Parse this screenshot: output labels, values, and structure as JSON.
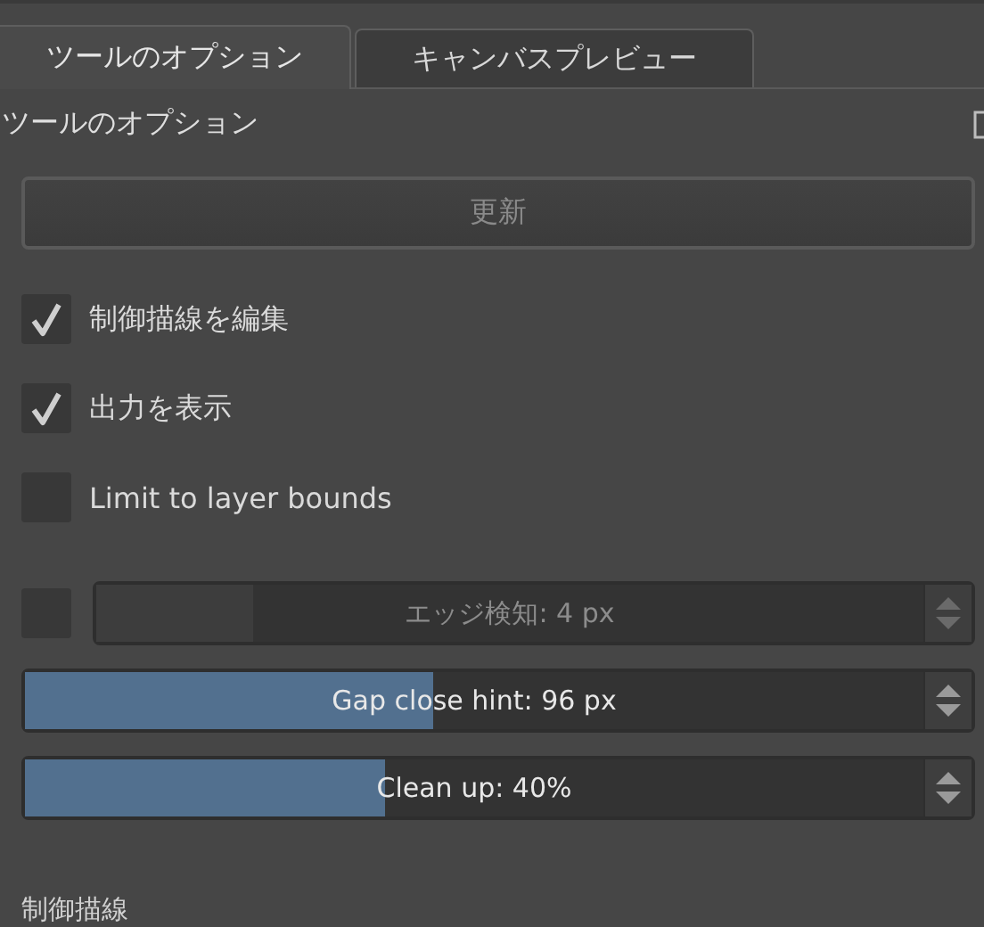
{
  "tabs": [
    {
      "label": "ツールのオプション",
      "selected": true
    },
    {
      "label": "キャンバスプレビュー",
      "selected": false
    }
  ],
  "panel": {
    "title": "ツールのオプション"
  },
  "update_button": {
    "label": "更新",
    "disabled": true
  },
  "checkboxes": [
    {
      "label": "制御描線を編集",
      "checked": true
    },
    {
      "label": "出力を表示",
      "checked": true
    },
    {
      "label": "Limit to layer bounds",
      "checked": false
    }
  ],
  "sliders": [
    {
      "label": "エッジ検知: 4 px",
      "level": 0.19,
      "disabled": true,
      "toggle": {
        "checked": false
      }
    },
    {
      "label": "Gap close hint: 96 px",
      "level": 0.455,
      "disabled": false
    },
    {
      "label": "Clean up: 40%",
      "level": 0.4,
      "disabled": false
    }
  ],
  "section_label": "制御描線"
}
